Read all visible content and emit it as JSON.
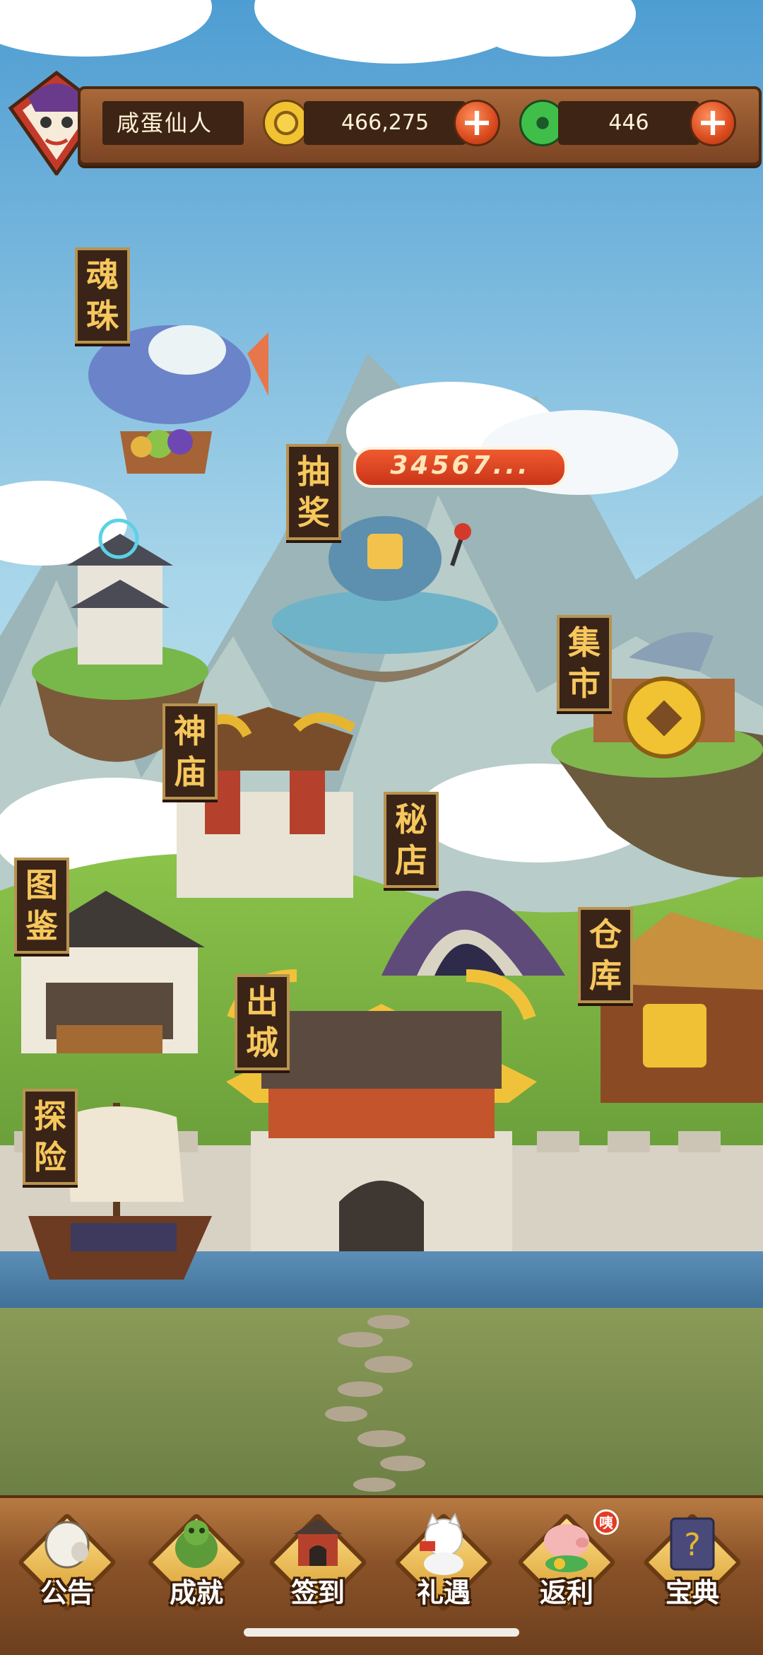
{
  "player": {
    "name": "咸蛋仙人"
  },
  "resources": {
    "coins": "466,275",
    "jade": "446"
  },
  "lottery": {
    "banner_text": "34567..."
  },
  "buildings": [
    {
      "id": "soul-orb",
      "label": [
        "魂",
        "珠"
      ]
    },
    {
      "id": "lottery",
      "label": [
        "抽",
        "奖"
      ]
    },
    {
      "id": "market",
      "label": [
        "集",
        "市"
      ]
    },
    {
      "id": "temple",
      "label": [
        "神",
        "庙"
      ]
    },
    {
      "id": "secret-shop",
      "label": [
        "秘",
        "店"
      ]
    },
    {
      "id": "codex",
      "label": [
        "图",
        "鉴"
      ]
    },
    {
      "id": "warehouse",
      "label": [
        "仓",
        "库"
      ]
    },
    {
      "id": "leave-city",
      "label": [
        "出",
        "城"
      ]
    },
    {
      "id": "explore",
      "label": [
        "探",
        "险"
      ]
    }
  ],
  "bottom_menu": [
    {
      "id": "announcement",
      "label": "公告",
      "icon": "megaphone-icon"
    },
    {
      "id": "achievement",
      "label": "成就",
      "icon": "jade-dragon-icon"
    },
    {
      "id": "checkin",
      "label": "签到",
      "icon": "gate-icon"
    },
    {
      "id": "gift",
      "label": "礼遇",
      "icon": "lucky-cat-icon"
    },
    {
      "id": "rebate",
      "label": "返利",
      "icon": "piggy-bank-icon",
      "badge": "咦"
    },
    {
      "id": "guide",
      "label": "宝典",
      "icon": "book-icon"
    }
  ],
  "colors": {
    "label_text": "#f6c75c",
    "label_bg": "#3a2418",
    "wood": "#8b5328",
    "banner_red": "#d9401f"
  }
}
